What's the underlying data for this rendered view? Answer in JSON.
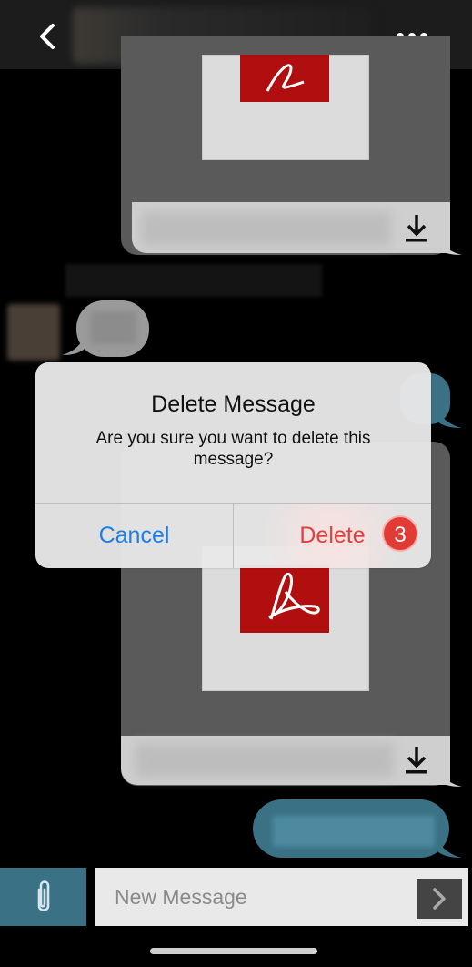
{
  "header": {
    "back_icon": "chevron-left-icon",
    "more_icon": "ellipsis-icon",
    "more_glyph": "•••"
  },
  "attachments": [
    {
      "file_icon": "pdf-icon",
      "download_icon": "download-icon",
      "download_glyph": "⤓"
    },
    {
      "file_icon": "pdf-icon",
      "download_icon": "download-icon",
      "download_glyph": "⤓"
    }
  ],
  "dialog": {
    "title": "Delete Message",
    "message": "Are you sure you want to delete this message?",
    "cancel_label": "Cancel",
    "delete_label": "Delete",
    "step_badge": "3"
  },
  "composer": {
    "attach_icon": "paperclip-icon",
    "attach_glyph": "⌀",
    "placeholder": "New Message",
    "send_icon": "chevron-right-icon",
    "send_glyph": "›"
  },
  "colors": {
    "accent_blue": "#1e7ee6",
    "destructive_red": "#e2403a",
    "teal": "#3a7185",
    "pdf_red": "#b10f0f"
  }
}
